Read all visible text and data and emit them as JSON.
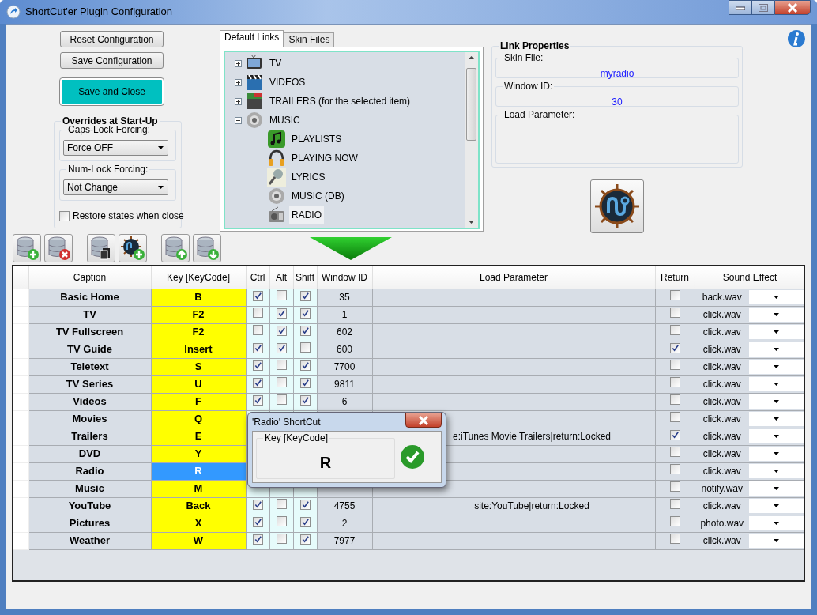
{
  "window": {
    "title": "ShortCut'er Plugin Configuration"
  },
  "buttons": [
    {
      "kind": "plain",
      "label": "Reset Configuration"
    },
    {
      "kind": "plain",
      "label": "Save Configuration"
    },
    {
      "kind": "accent",
      "label": "Save and Close"
    }
  ],
  "overrides": {
    "title": "Overrides at Start-Up",
    "caps_lock": {
      "label": "Caps-Lock Forcing:",
      "value": "Force OFF"
    },
    "num_lock": {
      "label": "Num-Lock Forcing:",
      "value": "Not Change"
    },
    "restore": {
      "label": "Restore states when close",
      "checked": false
    }
  },
  "tabs": [
    {
      "label": "Default Links",
      "selected": true
    },
    {
      "label": "Skin Files",
      "selected": false
    }
  ],
  "tree": [
    {
      "label": "TV",
      "kind": "tv",
      "expanded": false,
      "selected": false
    },
    {
      "label": "VIDEOS",
      "kind": "video",
      "expanded": false,
      "selected": false
    },
    {
      "label": "TRAILERS (for the selected item)",
      "kind": "trailer",
      "expanded": false,
      "selected": false
    },
    {
      "label": "MUSIC",
      "kind": "speaker",
      "expanded": true,
      "selected": false,
      "children": [
        {
          "label": "PLAYLISTS",
          "kind": "note",
          "selected": false
        },
        {
          "label": "PLAYING NOW",
          "kind": "headphones",
          "selected": false
        },
        {
          "label": "LYRICS",
          "kind": "mic",
          "selected": false
        },
        {
          "label": "MUSIC (DB)",
          "kind": "speaker",
          "selected": false
        },
        {
          "label": "RADIO",
          "kind": "radio",
          "selected": true
        }
      ]
    }
  ],
  "link_properties": {
    "title": "Link Properties",
    "skin_file": {
      "label": "Skin File:",
      "value": "myradio"
    },
    "window_id": {
      "label": "Window ID:",
      "value": "30"
    },
    "load_parameter": {
      "label": "Load Parameter:"
    }
  },
  "table": {
    "columns": [
      "Caption",
      "Key [KeyCode]",
      "Ctrl",
      "Alt",
      "Shift",
      "Window ID",
      "Load Parameter",
      "Return",
      "Sound Effect"
    ],
    "rows": [
      {
        "caption": "Basic Home",
        "key": "B",
        "selected": false,
        "ctrl": true,
        "alt": false,
        "shift": true,
        "window_id": "35",
        "return": false,
        "sound": "back.wav"
      },
      {
        "caption": "TV",
        "key": "F2",
        "selected": false,
        "ctrl": false,
        "alt": true,
        "shift": true,
        "window_id": "1",
        "return": false,
        "sound": "click.wav"
      },
      {
        "caption": "TV Fullscreen",
        "key": "F2",
        "selected": false,
        "ctrl": false,
        "alt": true,
        "shift": true,
        "window_id": "602",
        "return": false,
        "sound": "click.wav"
      },
      {
        "caption": "TV Guide",
        "key": "Insert",
        "selected": false,
        "ctrl": true,
        "alt": true,
        "shift": false,
        "window_id": "600",
        "return": true,
        "sound": "click.wav"
      },
      {
        "caption": "Teletext",
        "key": "S",
        "selected": false,
        "ctrl": true,
        "alt": false,
        "shift": true,
        "window_id": "7700",
        "return": false,
        "sound": "click.wav"
      },
      {
        "caption": "TV Series",
        "key": "U",
        "selected": false,
        "ctrl": true,
        "alt": false,
        "shift": true,
        "window_id": "9811",
        "return": false,
        "sound": "click.wav"
      },
      {
        "caption": "Videos",
        "key": "F",
        "selected": false,
        "ctrl": true,
        "alt": false,
        "shift": true,
        "window_id": "6",
        "return": false,
        "sound": "click.wav"
      },
      {
        "caption": "Movies",
        "key": "Q",
        "selected": false,
        "return": false,
        "sound": "click.wav"
      },
      {
        "caption": "Trailers",
        "key": "E",
        "selected": false,
        "load_parameter": "e:iTunes Movie Trailers|return:Locked",
        "return": true,
        "sound": "click.wav"
      },
      {
        "caption": "DVD",
        "key": "Y",
        "selected": false,
        "return": false,
        "sound": "click.wav"
      },
      {
        "caption": "Radio",
        "key": "R",
        "selected": true,
        "return": false,
        "sound": "click.wav"
      },
      {
        "caption": "Music",
        "key": "M",
        "selected": false,
        "return": false,
        "sound": "notify.wav"
      },
      {
        "caption": "YouTube",
        "key": "Back",
        "selected": false,
        "ctrl": true,
        "alt": false,
        "shift": true,
        "window_id": "4755",
        "load_parameter": "site:YouTube|return:Locked",
        "return": false,
        "sound": "click.wav"
      },
      {
        "caption": "Pictures",
        "key": "X",
        "selected": false,
        "ctrl": true,
        "alt": false,
        "shift": true,
        "window_id": "2",
        "return": false,
        "sound": "photo.wav"
      },
      {
        "caption": "Weather",
        "key": "W",
        "selected": false,
        "ctrl": true,
        "alt": false,
        "shift": true,
        "window_id": "7977",
        "return": false,
        "sound": "click.wav"
      }
    ]
  },
  "dialog": {
    "title": "'Radio' ShortCut",
    "group_label": "Key [KeyCode]",
    "key": "R"
  }
}
